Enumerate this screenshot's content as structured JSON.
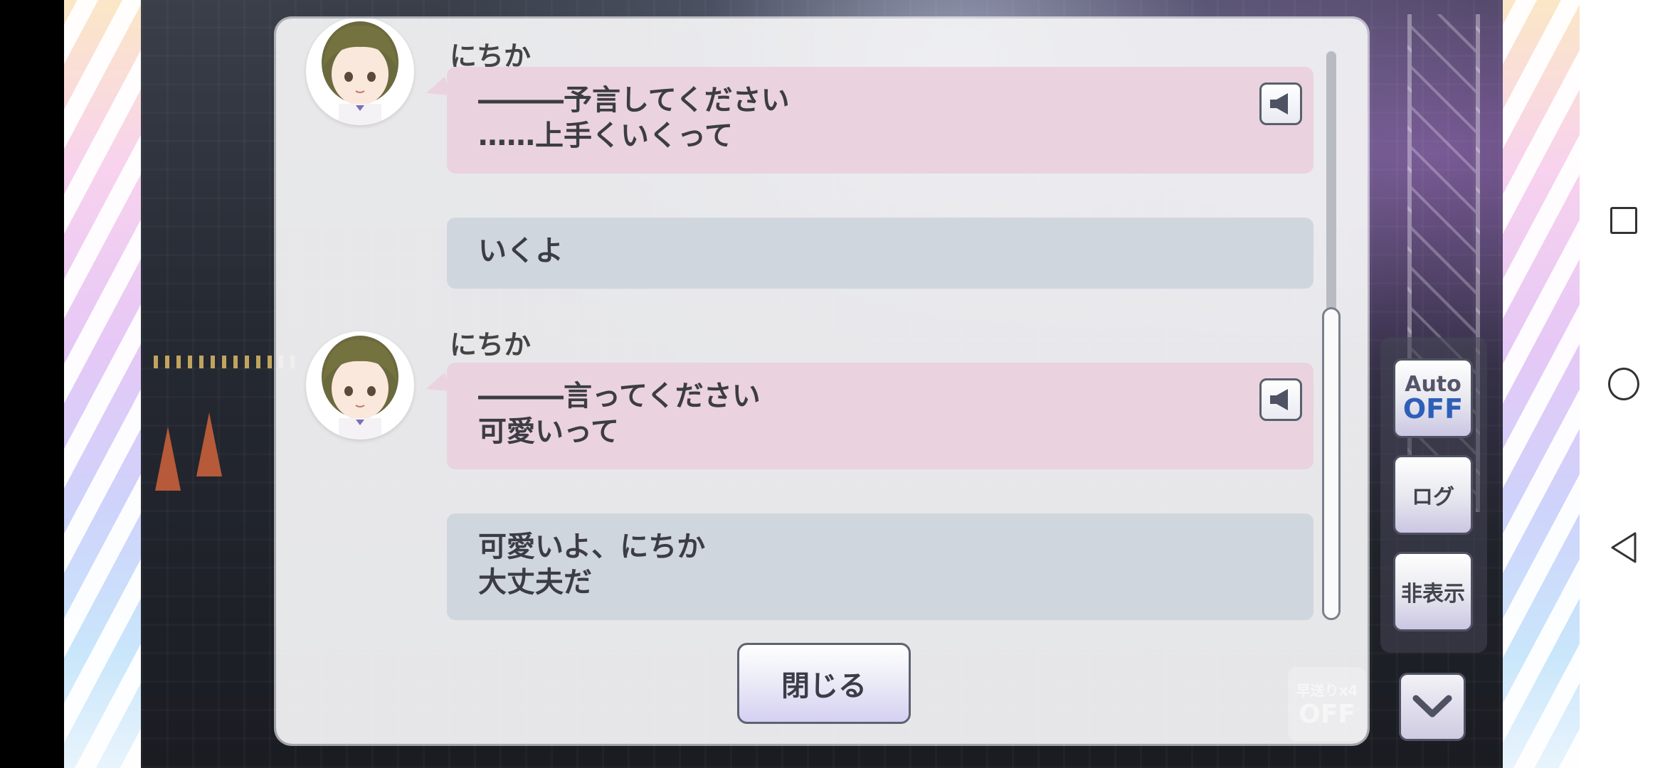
{
  "log": {
    "entries": [
      {
        "speaker": "にちか",
        "lines": [
          "―――予言してください",
          "……上手くいくって"
        ],
        "has_voice": true,
        "style": "character"
      },
      {
        "speaker": "",
        "lines": [
          "いくよ"
        ],
        "has_voice": false,
        "style": "player"
      },
      {
        "speaker": "にちか",
        "lines": [
          "―――言ってください",
          "可愛いって"
        ],
        "has_voice": true,
        "style": "character"
      },
      {
        "speaker": "",
        "lines": [
          "可愛いよ、にちか",
          "大丈夫だ"
        ],
        "has_voice": false,
        "style": "player"
      }
    ],
    "close_label": "閉じる",
    "scroll_position": 1.0
  },
  "controls": {
    "auto_label": "Auto",
    "auto_state": "OFF",
    "log_label": "ログ",
    "hide_label": "非表示",
    "fast_forward_label": "早送りx4",
    "fast_forward_state": "OFF"
  },
  "icons": {
    "voice": "speaker-icon",
    "down": "chevron-down-icon",
    "system_recent": "square-icon",
    "system_home": "circle-icon",
    "system_back": "triangle-back-icon"
  },
  "colors": {
    "character_bubble": "#ead3de",
    "player_bubble": "#d0d6de",
    "auto_off": "#2e5fb8"
  }
}
